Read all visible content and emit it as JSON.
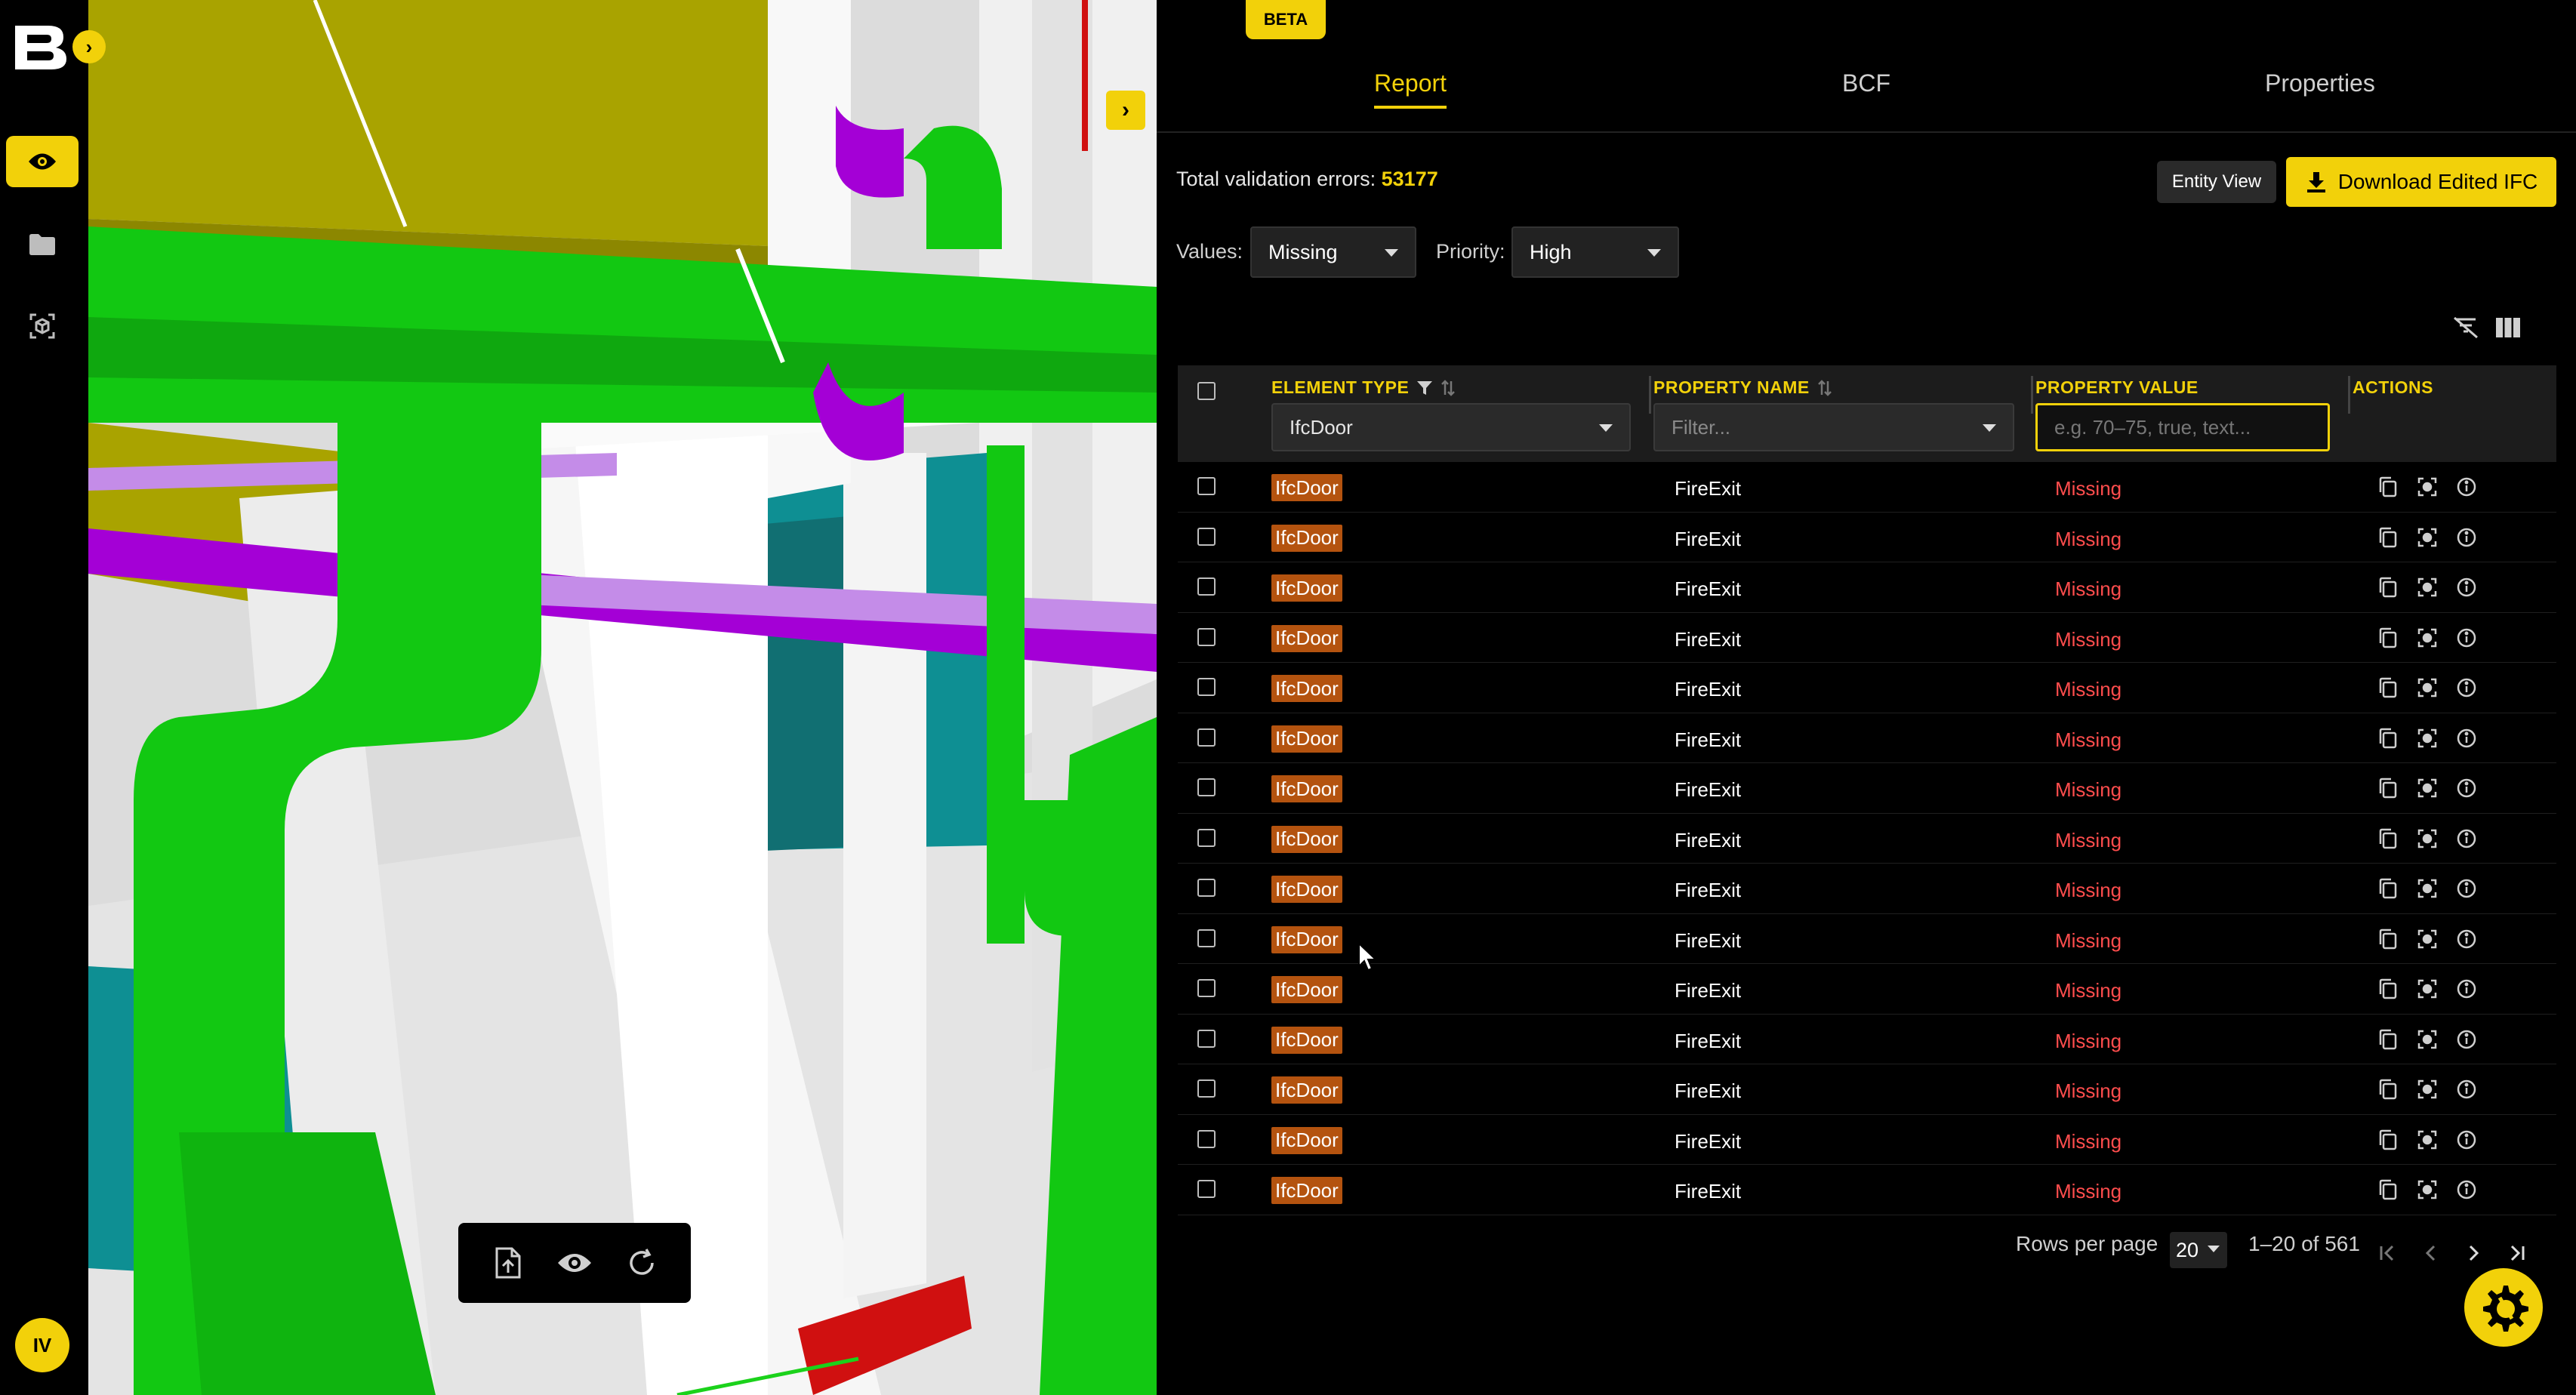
{
  "rail": {
    "items": [
      {
        "icon": "eye-icon",
        "active": true
      },
      {
        "icon": "folder-icon",
        "active": false
      },
      {
        "icon": "scan-3d-icon",
        "active": false
      }
    ],
    "avatar_initials": "IV"
  },
  "viewport": {
    "toolbar": [
      "upload-icon",
      "eye-icon",
      "refresh-icon"
    ]
  },
  "panel": {
    "beta_label": "BETA",
    "tabs": [
      {
        "label": "Report",
        "active": true
      },
      {
        "label": "BCF",
        "active": false
      },
      {
        "label": "Properties",
        "active": false
      }
    ],
    "total_label": "Total validation errors:",
    "total_value": "53177",
    "entity_view_label": "Entity View",
    "download_label": "Download Edited IFC",
    "filters": {
      "values_label": "Values:",
      "values_selected": "Missing",
      "priority_label": "Priority:",
      "priority_selected": "High"
    },
    "table": {
      "columns": {
        "element_type": "ELEMENT TYPE",
        "property_name": "PROPERTY NAME",
        "property_value": "PROPERTY VALUE",
        "actions": "ACTIONS"
      },
      "element_type_filter": "IfcDoor",
      "property_name_placeholder": "Filter...",
      "property_value_placeholder": "e.g. 70–75, true, text...",
      "rows": [
        {
          "type": "IfcDoor",
          "property": "FireExit",
          "value": "Missing"
        },
        {
          "type": "IfcDoor",
          "property": "FireExit",
          "value": "Missing"
        },
        {
          "type": "IfcDoor",
          "property": "FireExit",
          "value": "Missing"
        },
        {
          "type": "IfcDoor",
          "property": "FireExit",
          "value": "Missing"
        },
        {
          "type": "IfcDoor",
          "property": "FireExit",
          "value": "Missing"
        },
        {
          "type": "IfcDoor",
          "property": "FireExit",
          "value": "Missing"
        },
        {
          "type": "IfcDoor",
          "property": "FireExit",
          "value": "Missing"
        },
        {
          "type": "IfcDoor",
          "property": "FireExit",
          "value": "Missing"
        },
        {
          "type": "IfcDoor",
          "property": "FireExit",
          "value": "Missing"
        },
        {
          "type": "IfcDoor",
          "property": "FireExit",
          "value": "Missing"
        },
        {
          "type": "IfcDoor",
          "property": "FireExit",
          "value": "Missing"
        },
        {
          "type": "IfcDoor",
          "property": "FireExit",
          "value": "Missing"
        },
        {
          "type": "IfcDoor",
          "property": "FireExit",
          "value": "Missing"
        },
        {
          "type": "IfcDoor",
          "property": "FireExit",
          "value": "Missing"
        },
        {
          "type": "IfcDoor",
          "property": "FireExit",
          "value": "Missing"
        }
      ],
      "row_actions": [
        "copy-icon",
        "focus-icon",
        "info-icon"
      ]
    },
    "pagination": {
      "rows_per_page_label": "Rows per page",
      "rows_per_page": "20",
      "range": "1–20 of 561"
    }
  },
  "colors": {
    "accent": "#f2d10a",
    "type_badge": "#b4530f",
    "missing": "#ff4d4d",
    "pipe_green": "#12c812",
    "duct_olive": "#a9a300",
    "purple_pipe": "#a400d6"
  }
}
